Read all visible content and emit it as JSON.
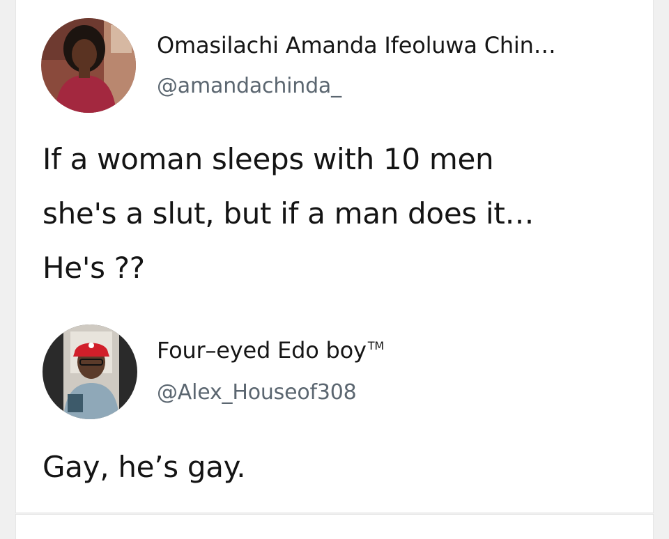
{
  "tweets": [
    {
      "author_name": "Omasilachi Amanda Ifeoluwa Chin…",
      "handle": "@amandachinda_",
      "avatar_icon": "profile-photo-woman",
      "text_lines": [
        "If a woman sleeps with 10 men",
        "she's a slut, but if a man does it…",
        "He's ??"
      ]
    },
    {
      "author_name": "Four–eyed Edo boy",
      "name_suffix": "TM",
      "handle": "@Alex_Houseof308",
      "avatar_icon": "profile-photo-man-red-cap",
      "text_lines": [
        "Gay, he’s gay."
      ]
    }
  ],
  "colors": {
    "background": "#f0f0f0",
    "card": "#ffffff",
    "text": "#141414",
    "handle": "#5b6670"
  }
}
